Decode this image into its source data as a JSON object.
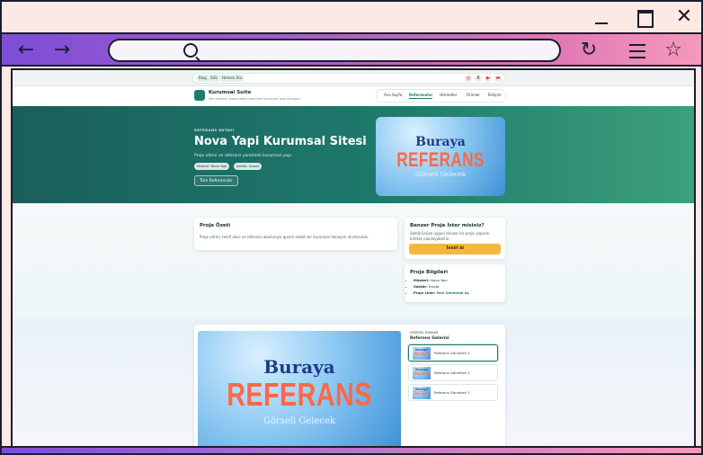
{
  "browser": {
    "window_controls": {
      "minimize_icon": "minimize-icon",
      "maximize_icon": "maximize-icon",
      "close_icon": "close-icon",
      "close_glyph": "✕"
    },
    "nav": {
      "back_glyph": "←",
      "forward_glyph": "→",
      "reload_glyph": "↻",
      "star_glyph": "☆"
    },
    "address": ""
  },
  "site": {
    "topbar": {
      "chips": [
        "Blog",
        "SSS",
        "Hemen Ara"
      ],
      "social": [
        "◎",
        "X",
        "▶",
        "▬"
      ]
    },
    "brand": {
      "name": "Kurumsal Suite",
      "tagline": "Her sektöre uyarlanabilir premium kurumsal web altyapısı"
    },
    "nav_items": [
      "Ana Sayfa",
      "Referanslar",
      "Hizmetler",
      "Ürünler",
      "İletişim"
    ],
    "hero": {
      "kicker": "REFERANS DETAYI",
      "title": "Nova Yapi Kurumsal Sitesi",
      "description": "Proje vitrini ve referans yonetimli kurumsal yapı.",
      "tags": [
        "Müşteri: Nova Yapi",
        "Sektör: İnsaat"
      ],
      "all_button": "Tüm Referanslar"
    },
    "placeholder_image": {
      "line1": "Buraya",
      "line2": "REFERANS",
      "line3": "Görseli Gelecek"
    },
    "summary": {
      "title": "Proje Özeti",
      "text": "Proje vitrini, teklif akisi ve referans alanlariyla guven odakli bir kurumsal deneyim olusturuldu."
    },
    "cta": {
      "title": "Benzer Proje İster misiniz?",
      "text": "Sektörünüze uygun benzer bir proje yapısını birlikte planlayabiliriz.",
      "button": "Teklif Al"
    },
    "info": {
      "title": "Proje Bilgileri",
      "customer_label": "Müşteri:",
      "customer_value": "Nova Yapi",
      "sector_label": "Sektör:",
      "sector_value": "İnsaat",
      "link_label": "Proje Linki:",
      "link_value": "Yeni Sekmede Aç"
    },
    "gallery": {
      "kicker": "GÖRSEL SUNUM",
      "title": "Referans Galerisi",
      "items": [
        "Referans Görselleri 1",
        "Referans Görselleri 1",
        "Referans Görselleri 1"
      ]
    }
  },
  "colors": {
    "hero_start": "#1a5f5a",
    "hero_end": "#3ca07a",
    "accent": "#1f7c6b",
    "cta": "#f6b73c",
    "frame_gradient_start": "#7d4dd8",
    "frame_gradient_end": "#f59ab9"
  }
}
